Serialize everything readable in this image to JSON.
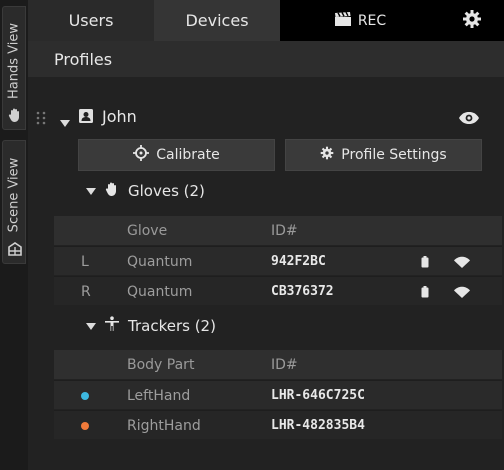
{
  "side_tabs": {
    "hands_view": "Hands View",
    "scene_view": "Scene View"
  },
  "tabs": {
    "users": "Users",
    "devices": "Devices",
    "rec": "REC"
  },
  "profiles_header": "Profiles",
  "profile": {
    "name": "John",
    "calibrate_label": "Calibrate",
    "settings_label": "Profile Settings"
  },
  "gloves": {
    "title": "Gloves (2)",
    "col_glove": "Glove",
    "col_id": "ID#",
    "rows": [
      {
        "side": "L",
        "type": "Quantum",
        "id": "942F2BC"
      },
      {
        "side": "R",
        "type": "Quantum",
        "id": "CB376372"
      }
    ]
  },
  "trackers": {
    "title": "Trackers (2)",
    "col_body": "Body Part",
    "col_id": "ID#",
    "rows": [
      {
        "part": "LeftHand",
        "id": "LHR-646C725C",
        "color": "#3db8e0"
      },
      {
        "part": "RightHand",
        "id": "LHR-482835B4",
        "color": "#f07a3a"
      }
    ]
  }
}
